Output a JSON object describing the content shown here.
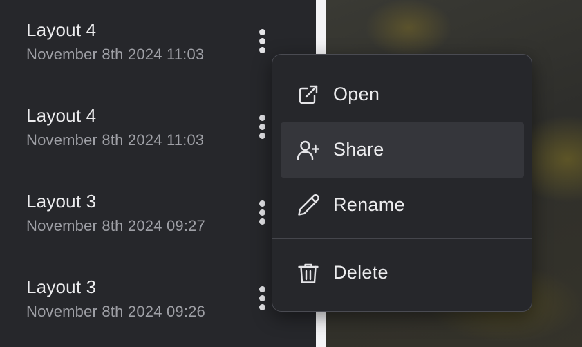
{
  "layouts": {
    "items": [
      {
        "title": "Layout 4",
        "date": "November 8th 2024 11:03"
      },
      {
        "title": "Layout 4",
        "date": "November 8th 2024 11:03"
      },
      {
        "title": "Layout 3",
        "date": "November 8th 2024 09:27"
      },
      {
        "title": "Layout 3",
        "date": "November 8th 2024 09:26"
      }
    ]
  },
  "context_menu": {
    "open_label": "Open",
    "share_label": "Share",
    "rename_label": "Rename",
    "delete_label": "Delete",
    "hovered_item": "Share"
  },
  "icons": {
    "kebab": "more-vertical-icon",
    "open": "external-link-icon",
    "share": "user-plus-icon",
    "rename": "pencil-icon",
    "delete": "trash-icon"
  },
  "colors": {
    "panel_bg": "#26272b",
    "hover_bg": "#35363b",
    "text_primary": "#ececee",
    "text_secondary": "#9fa0a6",
    "menu_border": "#4a4b52"
  }
}
